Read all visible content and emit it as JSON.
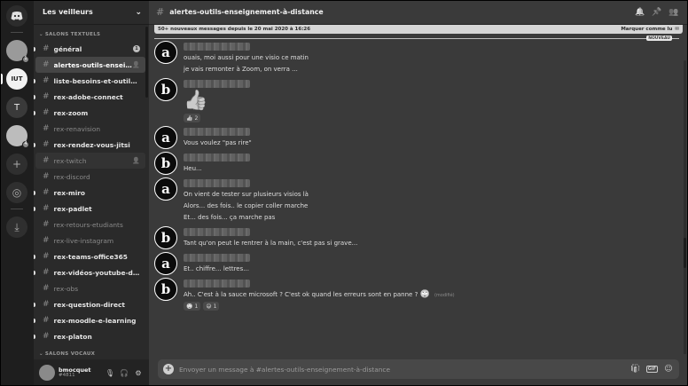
{
  "server": {
    "name": "Les veilleurs"
  },
  "rail": {
    "active_label": "IUT",
    "letter_server": "T",
    "badge_1": "1",
    "badge_2": "4"
  },
  "sidebar": {
    "category_text": "SALONS TEXTUELS",
    "category_voice": "SALONS VOCAUX",
    "channels": [
      {
        "name": "général",
        "badge": "1"
      },
      {
        "name": "alertes-outils-enseignement-à-distance"
      },
      {
        "name": "liste-besoins-et-outils-co..."
      },
      {
        "name": "rex-adobe-connect"
      },
      {
        "name": "rex-zoom"
      },
      {
        "name": "rex-renavision"
      },
      {
        "name": "rex-rendez-vous-jitsi"
      },
      {
        "name": "rex-twitch"
      },
      {
        "name": "rex-discord"
      },
      {
        "name": "rex-miro"
      },
      {
        "name": "rex-padlet"
      },
      {
        "name": "rex-retours-etudiants"
      },
      {
        "name": "rex-live-instagram"
      },
      {
        "name": "rex-teams-office365"
      },
      {
        "name": "rex-vidéos-youtube-droits"
      },
      {
        "name": "rex-obs"
      },
      {
        "name": "rex-question-direct"
      },
      {
        "name": "rex-moodle-e-learning"
      },
      {
        "name": "rex-platon"
      }
    ]
  },
  "user": {
    "name": "bmocquet",
    "tag": "#4811"
  },
  "channel": {
    "title": "alertes-outils-enseignement-à-distance"
  },
  "new_messages": {
    "text": "50+ nouveaux messages depuis le 20 mai 2020 à 16:26",
    "mark_read": "Marquer comme lu",
    "new_tag": "NOUVEAU"
  },
  "messages": [
    {
      "avatar": "a",
      "lines": [
        "ouais, moi aussi pour une visio ce matin",
        "je vais remonter à Zoom, on verra ..."
      ]
    },
    {
      "avatar": "b",
      "emoji": "👍",
      "reaction": {
        "emoji": "👍",
        "count": "2"
      }
    },
    {
      "avatar": "a",
      "lines": [
        "Vous voulez \"pas rire\""
      ]
    },
    {
      "avatar": "b",
      "lines": [
        "Heu..."
      ]
    },
    {
      "avatar": "a",
      "lines": [
        "On vient de tester sur plusieurs visios là",
        "Alors... des fois.. le copier coller marche",
        "Et... des fois... ça marche pas"
      ]
    },
    {
      "avatar": "b",
      "lines": [
        "Tant qu'on peut le rentrer à la main, c'est pas si grave..."
      ]
    },
    {
      "avatar": "a",
      "lines": [
        "Et.. chiffre... lettres..."
      ]
    },
    {
      "avatar": "b",
      "line": "Ah.. C'est à la sauce microsoft ? C'est ok quand les erreurs sont en panne ?",
      "edited": "(modifié)",
      "reactions": [
        {
          "emoji": "🙄",
          "count": "1"
        },
        {
          "emoji": "😅",
          "count": "1"
        }
      ]
    }
  ],
  "composer": {
    "placeholder": "Envoyer un message à #alertes-outils-enseignement-à-distance",
    "gif": "GIF"
  },
  "icons": {
    "bell": "bell-icon",
    "pin": "pin-icon",
    "members": "members-icon",
    "gift": "gift-icon",
    "emoji": "emoji-icon",
    "mute": "microphone-icon",
    "deafen": "headphones-icon",
    "settings": "gear-icon"
  }
}
